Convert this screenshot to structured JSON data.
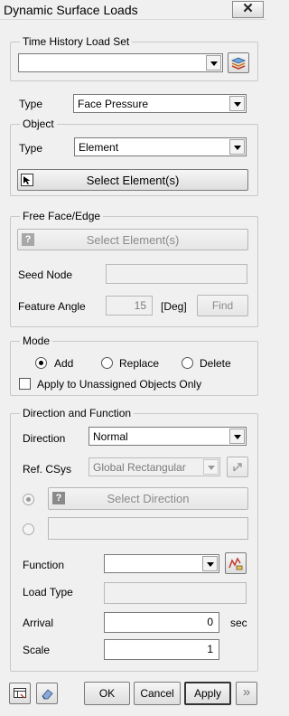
{
  "window": {
    "title": "Dynamic Surface Loads",
    "close_glyph": "✕"
  },
  "time_history": {
    "legend": "Time History Load Set",
    "value": "",
    "button_icon": "load-set-stack-icon"
  },
  "type_row": {
    "label": "Type",
    "value": "Face Pressure"
  },
  "object": {
    "legend": "Object",
    "type_label": "Type",
    "type_value": "Element",
    "select_button": "Select Element(s)",
    "select_icon": "cursor-select-icon"
  },
  "free_face": {
    "legend": "Free Face/Edge",
    "select_button": "Select Element(s)",
    "seed_node_label": "Seed Node",
    "seed_node_value": "",
    "feature_angle_label": "Feature Angle",
    "feature_angle_value": "15",
    "unit": "[Deg]",
    "find_button": "Find"
  },
  "mode": {
    "legend": "Mode",
    "options": [
      "Add",
      "Replace",
      "Delete"
    ],
    "selected": "Add",
    "checkbox_label": "Apply to Unassigned Objects Only",
    "checkbox_checked": false
  },
  "direction": {
    "legend": "Direction and Function",
    "direction_label": "Direction",
    "direction_value": "Normal",
    "csys_label": "Ref. CSys",
    "csys_value": "Global Rectangular",
    "select_direction_button": "Select Direction",
    "vector_value": "",
    "function_label": "Function",
    "function_value": "",
    "load_type_label": "Load Type",
    "load_type_value": "",
    "arrival_label": "Arrival",
    "arrival_value": "0",
    "arrival_unit": "sec",
    "scale_label": "Scale",
    "scale_value": "1"
  },
  "footer": {
    "ok": "OK",
    "cancel": "Cancel",
    "apply": "Apply",
    "more": "»"
  }
}
